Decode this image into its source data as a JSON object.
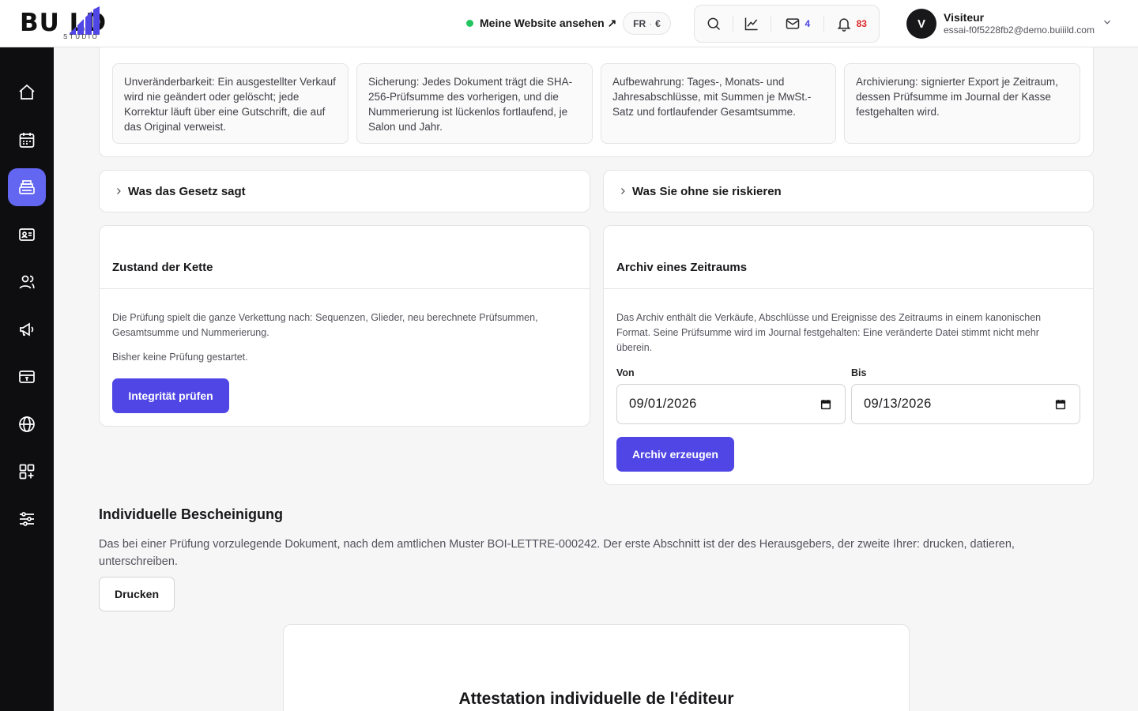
{
  "brand": {
    "logo_text": "BU  LD",
    "logo_sub": "STUDIO",
    "accent": "#4f46e5",
    "active_nav": "#6366f1"
  },
  "header": {
    "site_link": "Meine Website ansehen ↗",
    "lang": "FR",
    "currency": "€",
    "mail_count": "4",
    "notif_count": "83",
    "icons": [
      "search-icon",
      "chart-icon",
      "mail-icon",
      "bell-icon"
    ]
  },
  "user": {
    "initial": "V",
    "name": "Visiteur",
    "email": "essai-f0f5228fb2@demo.buiiild.com"
  },
  "sidebar": {
    "items": [
      {
        "icon": "home-icon",
        "active": false
      },
      {
        "icon": "calendar-icon",
        "active": false
      },
      {
        "icon": "register-icon",
        "active": true
      },
      {
        "icon": "contact-card-icon",
        "active": false
      },
      {
        "icon": "users-icon",
        "active": false
      },
      {
        "icon": "megaphone-icon",
        "active": false
      },
      {
        "icon": "payment-card-icon",
        "active": false
      },
      {
        "icon": "globe-icon",
        "active": false
      },
      {
        "icon": "apps-add-icon",
        "active": false
      },
      {
        "icon": "sliders-icon",
        "active": false
      }
    ]
  },
  "principles": [
    "Unveränderbarkeit: Ein ausgestellter Verkauf wird nie geändert oder gelöscht; jede Korrektur läuft über eine Gutschrift, die auf das Original verweist.",
    "Sicherung: Jedes Dokument trägt die SHA-256-Prüfsumme des vorherigen, und die Nummerierung ist lückenlos fortlaufend, je Salon und Jahr.",
    "Aufbewahrung: Tages-, Monats- und Jahresabschlüsse, mit Summen je MwSt.-Satz und fortlaufender Gesamtsumme.",
    "Archivierung: signierter Export je Zeitraum, dessen Prüfsumme im Journal der Kasse festgehalten wird."
  ],
  "accordions": {
    "law": "Was das Gesetz sagt",
    "risks": "Was Sie ohne sie riskieren"
  },
  "chain": {
    "title": "Zustand der Kette",
    "description": "Die Prüfung spielt die ganze Verkettung nach: Sequenzen, Glieder, neu berechnete Prüfsummen, Gesamtsumme und Nummerierung.",
    "status": "Bisher keine Prüfung gestartet.",
    "button": "Integrität prüfen"
  },
  "archive": {
    "title": "Archiv eines Zeitraums",
    "description": "Das Archiv enthält die Verkäufe, Abschlüsse und Ereignisse des Zeitraums in einem kanonischen Format. Seine Prüfsumme wird im Journal festgehalten: Eine veränderte Datei stimmt nicht mehr überein.",
    "from_label": "Von",
    "from_value": "09/01/2026",
    "to_label": "Bis",
    "to_value": "09/13/2026",
    "button": "Archiv erzeugen"
  },
  "certificate": {
    "title": "Individuelle Bescheinigung",
    "description": "Das bei einer Prüfung vorzulegende Dokument, nach dem amtlichen Muster BOI-LETTRE-000242. Der erste Abschnitt ist der des Herausgebers, der zweite Ihrer: drucken, datieren, unterschreiben.",
    "print_button": "Drucken",
    "preview_title": "Attestation individuelle de l'éditeur"
  }
}
